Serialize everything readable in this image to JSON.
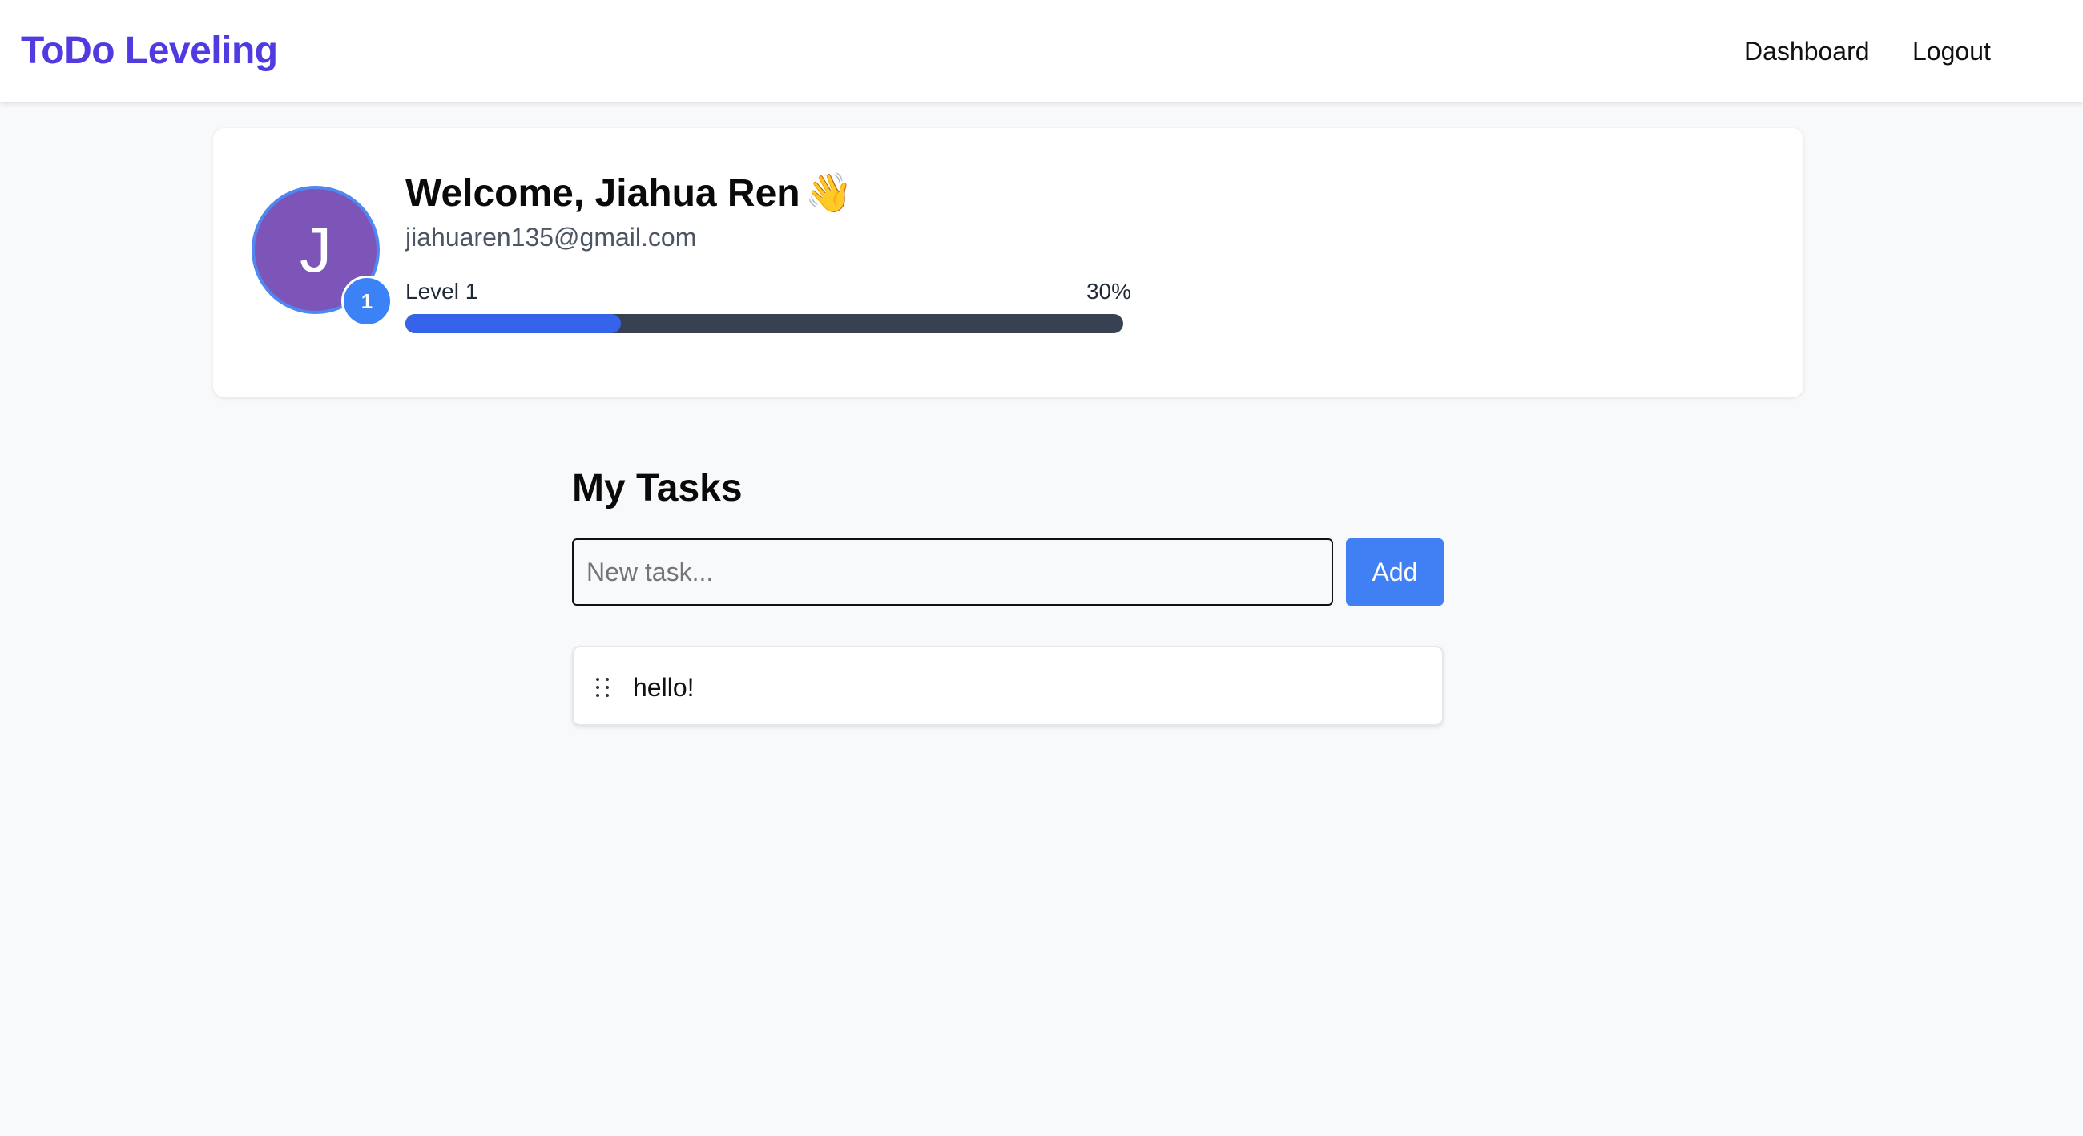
{
  "header": {
    "brand": "ToDo Leveling",
    "nav": {
      "dashboard": "Dashboard",
      "logout": "Logout"
    }
  },
  "profile": {
    "avatar_initial": "J",
    "level_badge": "1",
    "welcome": "Welcome, Jiahua Ren",
    "welcome_emoji": "👋",
    "email": "jiahuaren135@gmail.com",
    "level_label": "Level 1",
    "progress_label": "30%",
    "progress_value": 30
  },
  "tasks": {
    "title": "My Tasks",
    "input_placeholder": "New task...",
    "input_value": "",
    "add_label": "Add",
    "items": [
      {
        "text": "hello!"
      }
    ]
  },
  "colors": {
    "brand": "#4f3be0",
    "avatar_bg": "#7d55b8",
    "badge_bg": "#3b82f6",
    "progress_fill": "#3563e9",
    "progress_track": "#374151",
    "add_button": "#4180f4",
    "page_bg": "#f8f9fb"
  },
  "icons": {
    "drag_handle": "drag-handle-icon",
    "wave": "waving-hand-emoji"
  }
}
